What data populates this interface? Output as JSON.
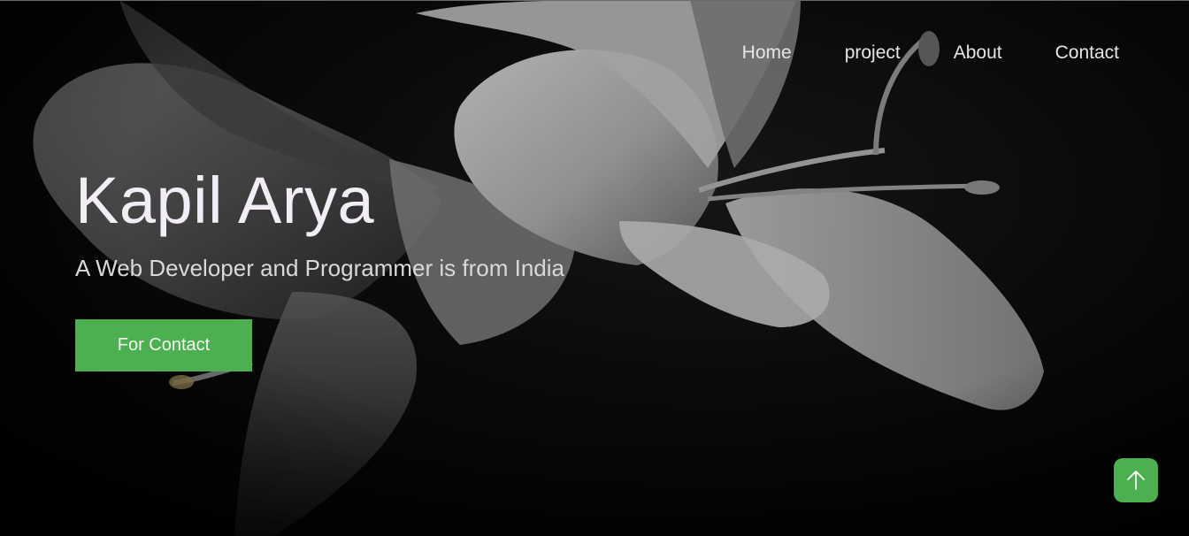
{
  "nav": {
    "items": [
      {
        "label": "Home"
      },
      {
        "label": "project"
      },
      {
        "label": "About"
      },
      {
        "label": "Contact"
      }
    ]
  },
  "hero": {
    "title": "Kapil Arya",
    "subtitle": "A Web Developer and Programmer is from India",
    "cta_label": "For Contact",
    "background": "monochrome-lily-photo"
  },
  "scroll_top": {
    "icon": "arrow-up-icon"
  },
  "colors": {
    "accent": "#4caf50",
    "background": "#050505",
    "title_text": "#f3eef5",
    "nav_text": "#e6e6e6"
  }
}
